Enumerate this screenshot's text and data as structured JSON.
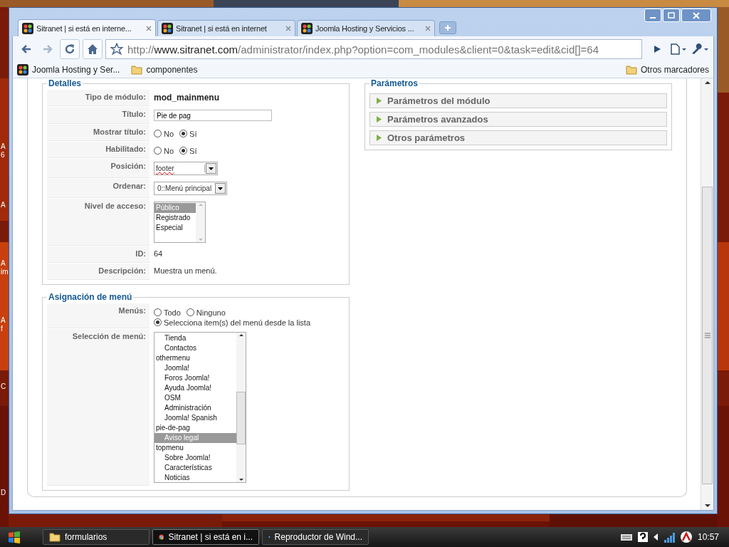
{
  "desktop_labels": [
    "A",
    "6",
    "A",
    "A",
    "im",
    "A",
    "f",
    "C",
    "D"
  ],
  "tabs": [
    {
      "title": "Sitranet | si está en interne...",
      "selected": true
    },
    {
      "title": "Sitranet | si está en internet",
      "selected": false
    },
    {
      "title": "Joomla Hosting y Servicios ...",
      "selected": false
    }
  ],
  "address_bar": {
    "scheme": "http://",
    "host": "www.sitranet.com",
    "path": "/administrator/index.php?option=com_modules&client=0&task=edit&cid[]=64"
  },
  "bookmarks": [
    {
      "label": "Joomla Hosting y Ser...",
      "kind": "site"
    },
    {
      "label": "componentes",
      "kind": "folder"
    }
  ],
  "other_bookmarks": "Otros marcadores",
  "details": {
    "legend": "Detalles",
    "rows": [
      {
        "label": "Tipo de módulo:",
        "kind": "strong",
        "value": "mod_mainmenu"
      },
      {
        "label": "Título:",
        "kind": "input",
        "value": "Pie de pag"
      },
      {
        "label": "Mostrar título:",
        "kind": "radio",
        "options": [
          {
            "label": "No",
            "selected": false
          },
          {
            "label": "Sí",
            "selected": true
          }
        ]
      },
      {
        "label": "Habilitado:",
        "kind": "radio",
        "options": [
          {
            "label": "No",
            "selected": false
          },
          {
            "label": "Sí",
            "selected": true
          }
        ]
      },
      {
        "label": "Posición:",
        "kind": "combo",
        "value": "footer"
      },
      {
        "label": "Ordenar:",
        "kind": "select",
        "value": "0::Menú principal"
      },
      {
        "label": "Nivel de acceso:",
        "kind": "listbox",
        "options": [
          {
            "label": "Público",
            "selected": true
          },
          {
            "label": "Registrado",
            "selected": false
          },
          {
            "label": "Especial",
            "selected": false
          }
        ]
      },
      {
        "label": "ID:",
        "kind": "text",
        "value": "64"
      },
      {
        "label": "Descripción:",
        "kind": "text",
        "value": "Muestra un menú."
      }
    ]
  },
  "parameters": {
    "legend": "Parámetros",
    "panels": [
      {
        "title": "Parámetros del módulo",
        "expanded": false
      },
      {
        "title": "Parámetros avanzados",
        "expanded": false
      },
      {
        "title": "Otros parámetros",
        "expanded": false
      }
    ]
  },
  "menu_assignment": {
    "legend": "Asignación de menú",
    "rows": [
      {
        "label": "Menús:",
        "kind": "radio",
        "options": [
          {
            "label": "Todo",
            "selected": false
          },
          {
            "label": "Ninguno",
            "selected": false
          },
          {
            "label": "Selecciona item(s) del menú desde la lista",
            "selected": true
          }
        ]
      },
      {
        "label": "Selección de menú:",
        "kind": "tree",
        "groups": [
          {
            "children": [
              {
                "label": "Tienda",
                "selected": false
              },
              {
                "label": "Contactos",
                "selected": false
              }
            ]
          },
          {
            "label": "othermenu",
            "children": [
              {
                "label": "Joomla!",
                "selected": false
              },
              {
                "label": "Foros Joomla!",
                "selected": false
              },
              {
                "label": "Ayuda Joomla!",
                "selected": false
              },
              {
                "label": "OSM",
                "selected": false
              },
              {
                "label": "Administración",
                "selected": false
              },
              {
                "label": "Joomla! Spanish",
                "selected": false
              }
            ]
          },
          {
            "label": "pie-de-pag",
            "children": [
              {
                "label": "Aviso legal",
                "selected": true
              }
            ]
          },
          {
            "label": "topmenu",
            "children": [
              {
                "label": "Sobre Joomla!",
                "selected": false
              },
              {
                "label": "Características",
                "selected": false
              },
              {
                "label": "Noticias",
                "selected": false
              }
            ]
          }
        ]
      }
    ]
  },
  "taskbar": {
    "items": [
      {
        "label": "formularios",
        "kind": "folder",
        "selected": false
      },
      {
        "label": "Sitranet | si está en i...",
        "kind": "browser",
        "selected": true
      },
      {
        "label": "Reproductor de Wind...",
        "kind": "media",
        "selected": false
      }
    ],
    "clock": "10:57"
  }
}
